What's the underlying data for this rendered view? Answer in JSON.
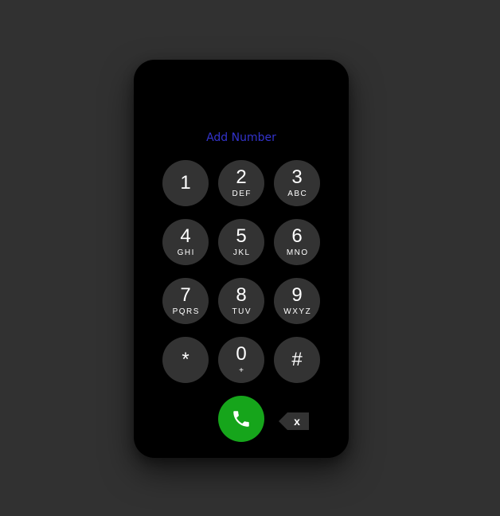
{
  "dialer": {
    "add_number_label": "Add Number",
    "keys": [
      {
        "digit": "1",
        "letters": ""
      },
      {
        "digit": "2",
        "letters": "DEF"
      },
      {
        "digit": "3",
        "letters": "ABC"
      },
      {
        "digit": "4",
        "letters": "GHI"
      },
      {
        "digit": "5",
        "letters": "JKL"
      },
      {
        "digit": "6",
        "letters": "MNO"
      },
      {
        "digit": "7",
        "letters": "PQRS"
      },
      {
        "digit": "8",
        "letters": "TUV"
      },
      {
        "digit": "9",
        "letters": "WXYZ"
      },
      {
        "digit": "*",
        "letters": ""
      },
      {
        "digit": "0",
        "letters": "+"
      },
      {
        "digit": "#",
        "letters": ""
      }
    ],
    "call_icon": "phone-icon",
    "backspace_label": "x",
    "colors": {
      "background": "#313131",
      "phone_body": "#000000",
      "key_fill": "#333333",
      "add_number_text": "#3333cc",
      "call_button": "#16a51b",
      "backspace_fill": "#333333"
    }
  }
}
